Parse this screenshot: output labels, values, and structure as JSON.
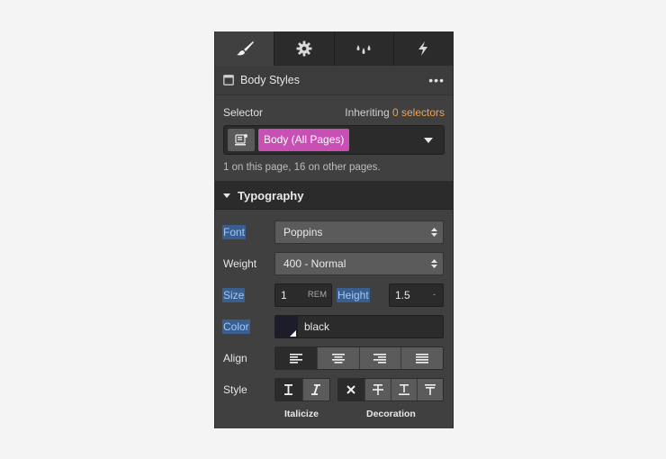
{
  "tabs": [
    {
      "name": "style",
      "icon": "paintbrush-icon",
      "active": true
    },
    {
      "name": "settings",
      "icon": "gear-icon",
      "active": false
    },
    {
      "name": "style-manager",
      "icon": "drops-icon",
      "active": false
    },
    {
      "name": "interactions",
      "icon": "lightning-icon",
      "active": false
    }
  ],
  "header": {
    "title": "Body Styles",
    "more": "•••"
  },
  "selector": {
    "label": "Selector",
    "inheriting_prefix": "Inheriting",
    "inheriting_count": "0 selectors",
    "tag": "Body (All Pages)",
    "note": "1 on this page, 16 on other pages."
  },
  "typography": {
    "title": "Typography",
    "font_label": "Font",
    "font_value": "Poppins",
    "weight_label": "Weight",
    "weight_value": "400 - Normal",
    "size_label": "Size",
    "size_value": "1",
    "size_unit": "REM",
    "height_label": "Height",
    "height_value": "1.5",
    "height_unit": "-",
    "color_label": "Color",
    "color_value": "black",
    "align_label": "Align",
    "style_label": "Style",
    "italicize_caption": "Italicize",
    "decoration_caption": "Decoration"
  },
  "colors": {
    "accent_tag": "#c84fb4",
    "inherit_orange": "#f4a24b",
    "highlight": "#3a5f8f"
  }
}
